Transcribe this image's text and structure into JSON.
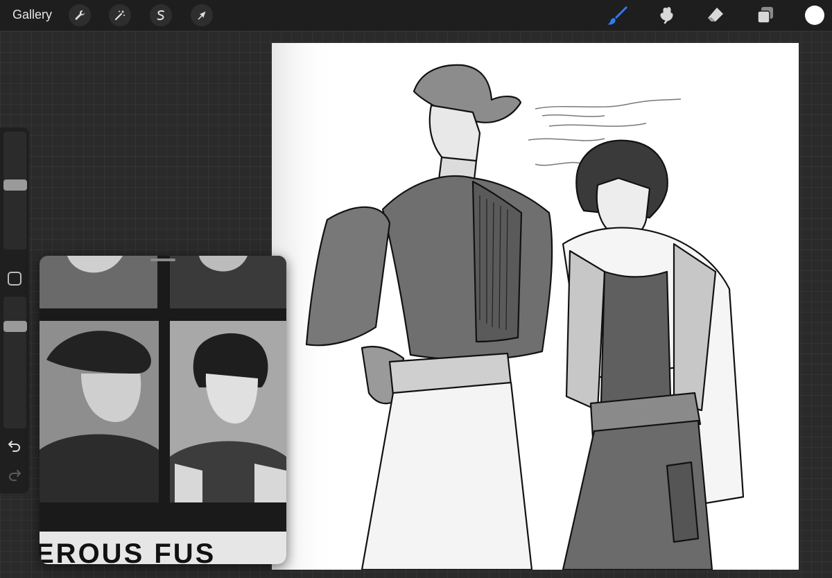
{
  "toolbar": {
    "gallery_label": "Gallery",
    "left_tools": [
      "wrench-icon",
      "magic-wand-icon",
      "selection-icon",
      "transform-arrow-icon"
    ],
    "right_tools": [
      "brush-icon",
      "smudge-icon",
      "eraser-icon",
      "layers-icon"
    ],
    "active_tool": "brush-icon",
    "accent_color": "#2f7cf6",
    "current_color": "#ffffff"
  },
  "sidebar": {
    "brush_size_level": 0.55,
    "opacity_level": 0.8,
    "controls": [
      "modify-button",
      "undo-button",
      "redo-button"
    ],
    "redo_enabled": false
  },
  "reference": {
    "caption_text": "EROUS FUS"
  }
}
